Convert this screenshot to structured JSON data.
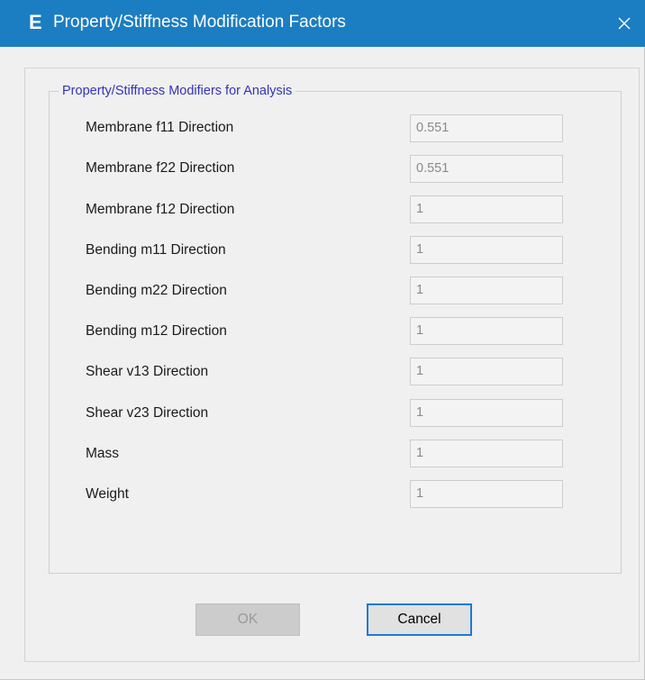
{
  "window": {
    "title": "Property/Stiffness Modification Factors",
    "app_icon_letter": "E",
    "accent_color": "#1b7ec2"
  },
  "group": {
    "title": "Property/Stiffness Modifiers for Analysis",
    "rows": [
      {
        "label": "Membrane f11 Direction",
        "value": "0.551"
      },
      {
        "label": "Membrane f22 Direction",
        "value": "0.551"
      },
      {
        "label": "Membrane f12 Direction",
        "value": "1"
      },
      {
        "label": "Bending m11 Direction",
        "value": "1"
      },
      {
        "label": "Bending m22 Direction",
        "value": "1"
      },
      {
        "label": "Bending m12 Direction",
        "value": "1"
      },
      {
        "label": "Shear v13 Direction",
        "value": "1"
      },
      {
        "label": "Shear v23 Direction",
        "value": "1"
      },
      {
        "label": "Mass",
        "value": "1"
      },
      {
        "label": "Weight",
        "value": "1"
      }
    ]
  },
  "buttons": {
    "ok_label": "OK",
    "cancel_label": "Cancel"
  }
}
